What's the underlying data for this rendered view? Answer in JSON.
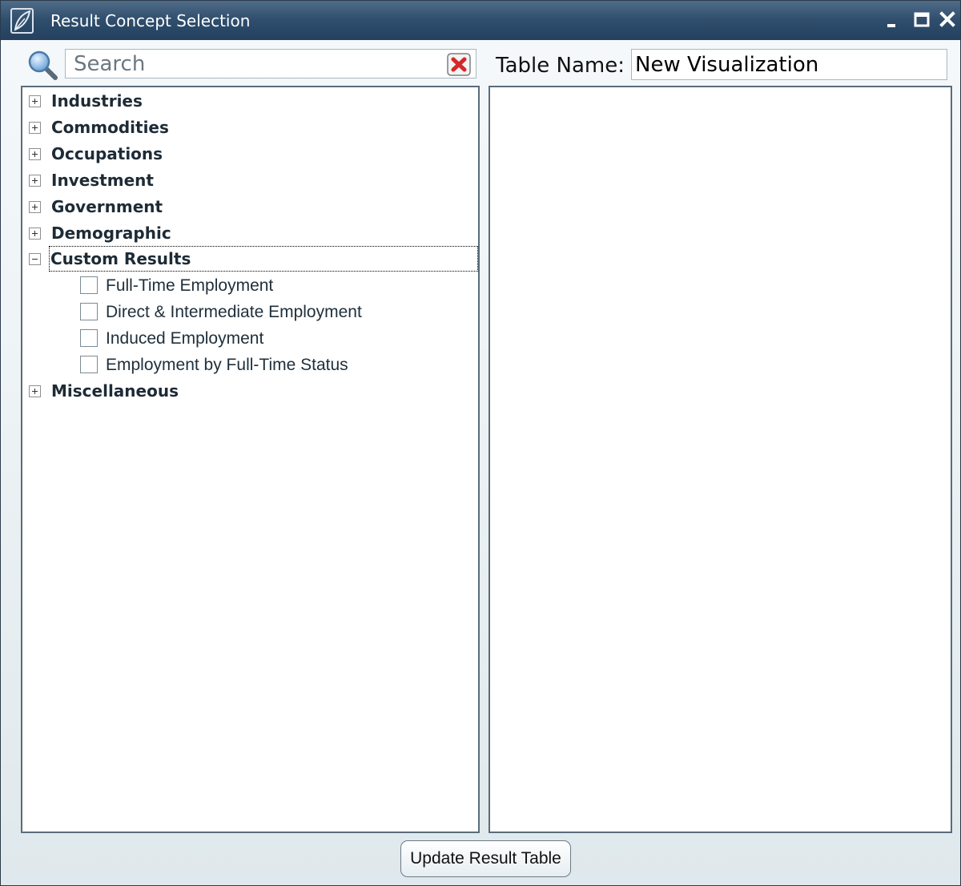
{
  "window": {
    "title": "Result Concept Selection",
    "icon": "leaf-icon",
    "controls": [
      "minimize-icon",
      "maximize-icon",
      "close-icon"
    ]
  },
  "search": {
    "placeholder": "Search",
    "value": "",
    "icon": "magnifier-icon",
    "clear_icon": "clear-x-icon"
  },
  "table_name": {
    "label": "Table Name:",
    "value": "New Visualization"
  },
  "tree": {
    "nodes": [
      {
        "label": "Industries",
        "expanded": false
      },
      {
        "label": "Commodities",
        "expanded": false
      },
      {
        "label": "Occupations",
        "expanded": false
      },
      {
        "label": "Investment",
        "expanded": false
      },
      {
        "label": "Government",
        "expanded": false
      },
      {
        "label": "Demographic",
        "expanded": false
      },
      {
        "label": "Custom Results",
        "expanded": true,
        "selected": true,
        "children": [
          {
            "label": "Full-Time Employment",
            "checked": false
          },
          {
            "label": "Direct & Intermediate Employment",
            "checked": false
          },
          {
            "label": "Induced Employment",
            "checked": false
          },
          {
            "label": "Employment by Full-Time Status",
            "checked": false
          }
        ]
      },
      {
        "label": "Miscellaneous",
        "expanded": false
      }
    ]
  },
  "footer": {
    "update_button": "Update Result Table"
  },
  "colors": {
    "titlebar": "#2f4d6c",
    "panel_border": "#5a6c7b",
    "background": "#eef3f5"
  }
}
